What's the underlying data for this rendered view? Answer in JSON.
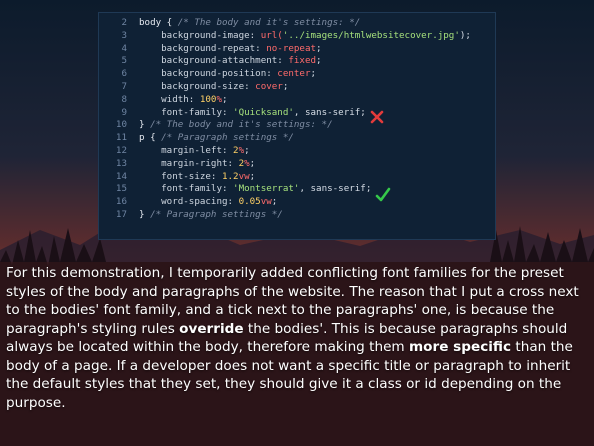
{
  "code_lines": [
    {
      "n": "2",
      "parts": [
        {
          "t": "body { ",
          "c": "kw"
        },
        {
          "t": "/* The body and it's settings: */",
          "c": "cmt"
        }
      ]
    },
    {
      "n": "3",
      "parts": [
        {
          "t": "    background-image: ",
          "c": "prop"
        },
        {
          "t": "url(",
          "c": "val"
        },
        {
          "t": "'../images/htmlwebsitecover.jpg'",
          "c": "str"
        },
        {
          "t": ");",
          "c": "code"
        }
      ]
    },
    {
      "n": "4",
      "parts": [
        {
          "t": "    background-repeat: ",
          "c": "prop"
        },
        {
          "t": "no-repeat",
          "c": "val"
        },
        {
          "t": ";",
          "c": "code"
        }
      ]
    },
    {
      "n": "5",
      "parts": [
        {
          "t": "    background-attachment: ",
          "c": "prop"
        },
        {
          "t": "fixed",
          "c": "val"
        },
        {
          "t": ";",
          "c": "code"
        }
      ]
    },
    {
      "n": "6",
      "parts": [
        {
          "t": "    background-position: ",
          "c": "prop"
        },
        {
          "t": "center",
          "c": "val"
        },
        {
          "t": ";",
          "c": "code"
        }
      ]
    },
    {
      "n": "7",
      "parts": [
        {
          "t": "    background-size: ",
          "c": "prop"
        },
        {
          "t": "cover",
          "c": "val"
        },
        {
          "t": ";",
          "c": "code"
        }
      ]
    },
    {
      "n": "8",
      "parts": [
        {
          "t": "    width: ",
          "c": "prop"
        },
        {
          "t": "100",
          "c": "num"
        },
        {
          "t": "%",
          "c": "val"
        },
        {
          "t": ";",
          "c": "code"
        }
      ]
    },
    {
      "n": "9",
      "parts": [
        {
          "t": "    font-family: ",
          "c": "prop"
        },
        {
          "t": "'Quicksand'",
          "c": "str"
        },
        {
          "t": ", sans-serif;",
          "c": "code"
        }
      ],
      "mark": "x"
    },
    {
      "n": "10",
      "parts": [
        {
          "t": "} ",
          "c": "kw"
        },
        {
          "t": "/* The body and it's settings: */",
          "c": "cmt"
        }
      ]
    },
    {
      "n": "11",
      "parts": [
        {
          "t": "p { ",
          "c": "kw"
        },
        {
          "t": "/* Paragraph settings */",
          "c": "cmt"
        }
      ]
    },
    {
      "n": "12",
      "parts": [
        {
          "t": "    margin-left: ",
          "c": "prop"
        },
        {
          "t": "2",
          "c": "num"
        },
        {
          "t": "%",
          "c": "val"
        },
        {
          "t": ";",
          "c": "code"
        }
      ]
    },
    {
      "n": "13",
      "parts": [
        {
          "t": "    margin-right: ",
          "c": "prop"
        },
        {
          "t": "2",
          "c": "num"
        },
        {
          "t": "%",
          "c": "val"
        },
        {
          "t": ";",
          "c": "code"
        }
      ]
    },
    {
      "n": "14",
      "parts": [
        {
          "t": "    font-size: ",
          "c": "prop"
        },
        {
          "t": "1.2",
          "c": "num"
        },
        {
          "t": "vw",
          "c": "val"
        },
        {
          "t": ";",
          "c": "code"
        }
      ]
    },
    {
      "n": "15",
      "parts": [
        {
          "t": "    font-family: ",
          "c": "prop"
        },
        {
          "t": "'Montserrat'",
          "c": "str"
        },
        {
          "t": ", sans-serif;",
          "c": "code"
        }
      ],
      "mark": "check"
    },
    {
      "n": "16",
      "parts": [
        {
          "t": "    word-spacing: ",
          "c": "prop"
        },
        {
          "t": "0.05",
          "c": "num"
        },
        {
          "t": "vw",
          "c": "val"
        },
        {
          "t": ";",
          "c": "code"
        }
      ]
    },
    {
      "n": "17",
      "parts": [
        {
          "t": "} ",
          "c": "kw"
        },
        {
          "t": "/* Paragraph settings */",
          "c": "cmt"
        }
      ]
    }
  ],
  "marks": {
    "cross_icon": "cross-icon",
    "check_icon": "check-icon",
    "cross_color": "#e23b3b",
    "check_color": "#35c84a"
  },
  "description": {
    "p1": "For this demonstration, I temporarily added conflicting font families for the preset styles of the body and paragraphs of the website. The reason that I put a cross next to the bodies' font family, and a tick next to the paragraphs' one, is because the paragraph's styling rules ",
    "b1": "override",
    "p2": " the bodies'. This is because paragraphs should always be located within the body, therefore making them ",
    "b2": "more specific",
    "p3": " than the body of a page. If a developer does not want a specific title or paragraph to inherit the default styles that they set, they should give it a class or id depending on the purpose."
  },
  "colors": {
    "sky_top": "#0b1a2a",
    "sky_mid": "#5a2a2a",
    "sunset": "#e07a30",
    "panel": "#0f2135"
  }
}
